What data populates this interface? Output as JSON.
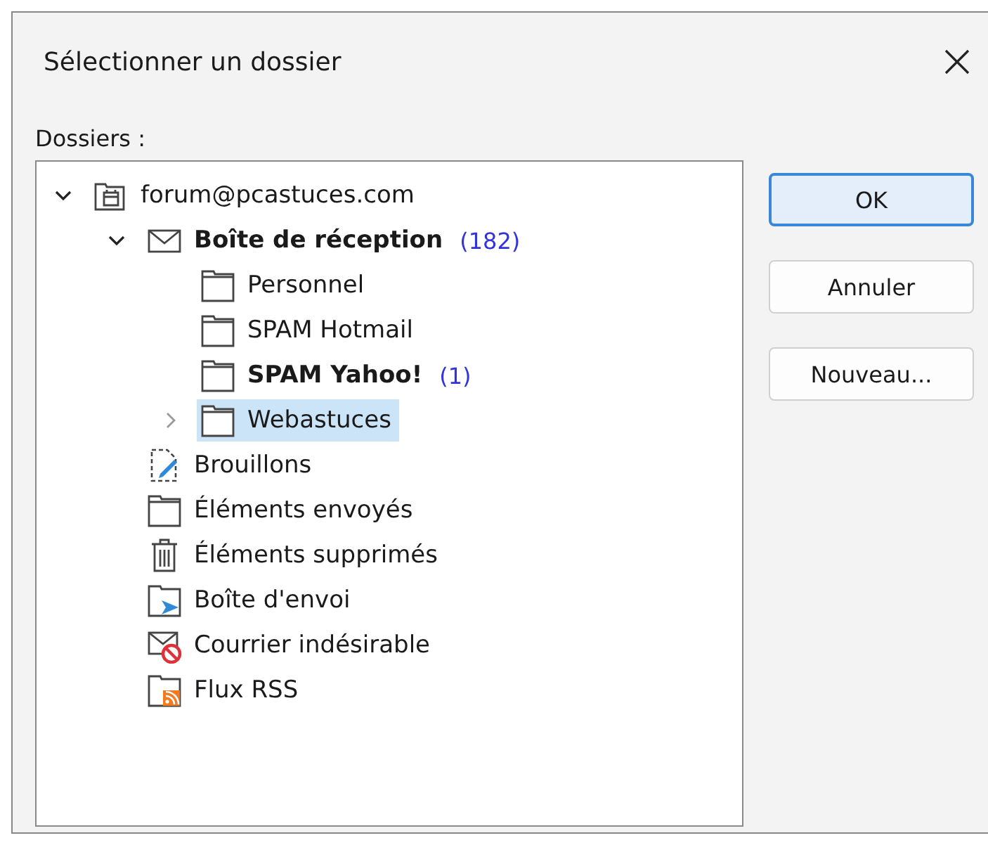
{
  "window": {
    "title": "Sélectionner un dossier"
  },
  "tree_label": "Dossiers :",
  "tree": [
    {
      "name": "forum@pcastuces.com",
      "kind": "account",
      "expanded": true,
      "selected": false,
      "children": [
        {
          "name": "Boîte de réception",
          "kind": "inbox",
          "bold": true,
          "count": "(182)",
          "expanded": true,
          "selected": false,
          "children": [
            {
              "name": "Personnel",
              "kind": "folder",
              "selected": false
            },
            {
              "name": "SPAM Hotmail",
              "kind": "folder",
              "selected": false
            },
            {
              "name": "SPAM Yahoo!",
              "kind": "folder",
              "bold": true,
              "count": "(1)",
              "selected": false
            },
            {
              "name": "Webastuces",
              "kind": "folder",
              "expanded": false,
              "selected": true
            }
          ]
        },
        {
          "name": "Brouillons",
          "kind": "drafts",
          "selected": false
        },
        {
          "name": "Éléments envoyés",
          "kind": "folder",
          "selected": false
        },
        {
          "name": "Éléments supprimés",
          "kind": "trash",
          "selected": false
        },
        {
          "name": "Boîte d'envoi",
          "kind": "outbox",
          "selected": false
        },
        {
          "name": "Courrier indésirable",
          "kind": "junk",
          "selected": false
        },
        {
          "name": "Flux RSS",
          "kind": "rss",
          "selected": false
        }
      ]
    }
  ],
  "buttons": [
    {
      "label": "OK",
      "default": true
    },
    {
      "label": "Annuler",
      "default": false
    },
    {
      "label": "Nouveau...",
      "default": false
    }
  ]
}
